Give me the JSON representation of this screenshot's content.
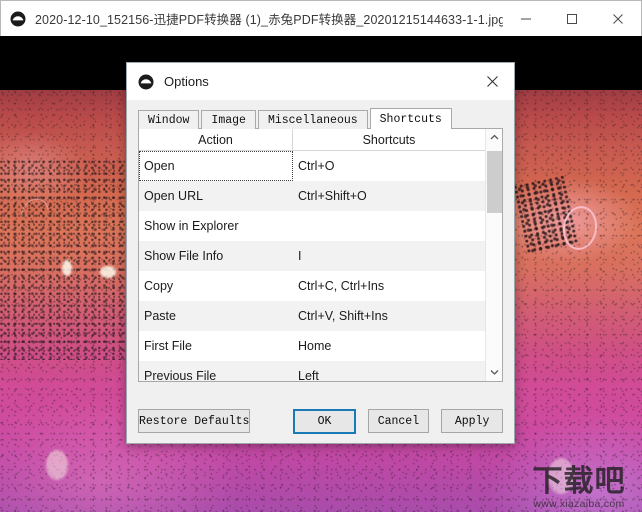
{
  "window": {
    "title": "2020-12-10_152156-迅捷PDF转换器 (1)_赤兔PDF转换器_20201215144633-1-1.jpg",
    "app_icon": "honeyview-icon",
    "controls": {
      "minimize": "minimize-icon",
      "maximize": "maximize-icon",
      "close": "close-icon"
    }
  },
  "dialog": {
    "title": "Options",
    "icon": "honeyview-icon",
    "close": "close-icon",
    "tabs": [
      {
        "label": "Window",
        "active": false
      },
      {
        "label": "Image",
        "active": false
      },
      {
        "label": "Miscellaneous",
        "active": false
      },
      {
        "label": "Shortcuts",
        "active": true
      }
    ],
    "table": {
      "columns": [
        "Action",
        "Shortcuts"
      ],
      "rows": [
        {
          "action": "Open",
          "shortcut": "Ctrl+O",
          "focused": true
        },
        {
          "action": "Open URL",
          "shortcut": "Ctrl+Shift+O",
          "focused": false
        },
        {
          "action": "Show in Explorer",
          "shortcut": "",
          "focused": false
        },
        {
          "action": "Show File Info",
          "shortcut": "I",
          "focused": false
        },
        {
          "action": "Copy",
          "shortcut": "Ctrl+C, Ctrl+Ins",
          "focused": false
        },
        {
          "action": "Paste",
          "shortcut": "Ctrl+V, Shift+Ins",
          "focused": false
        },
        {
          "action": "First File",
          "shortcut": "Home",
          "focused": false
        },
        {
          "action": "Previous File",
          "shortcut": "Left",
          "focused": false
        }
      ]
    },
    "scrollbar": {
      "up_arrow": "chevron-up-icon",
      "down_arrow": "chevron-down-icon"
    },
    "buttons": {
      "restore_defaults": "Restore Defaults",
      "ok": "OK",
      "cancel": "Cancel",
      "apply": "Apply"
    }
  },
  "watermark": {
    "cn": "下载吧",
    "url": "www.xiazaiba.com"
  },
  "colors": {
    "focus_blue": "#1a7ab5",
    "dialog_bg": "#f0f0f0",
    "row_alt": "#f2f2f2"
  }
}
